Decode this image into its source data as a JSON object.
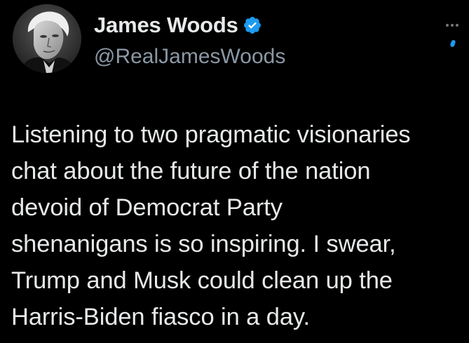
{
  "author": {
    "display_name": "James Woods",
    "handle": "@RealJamesWoods",
    "verified_icon": "verified-badge-icon",
    "avatar_icon": "profile-photo"
  },
  "menu": {
    "icon": "more-options-icon"
  },
  "tweet": {
    "text": "Listening to two pragmatic visionaries\nchat about the future of the nation\ndevoid of Democrat Party\nshenanigans is so inspiring. I swear,\nTrump and Musk could clean up the\nHarris-Biden fiasco in a day."
  },
  "colors": {
    "background": "#000000",
    "text": "#e7e9ea",
    "secondary_text": "#8b98a5",
    "verified_blue": "#1d9bf0"
  }
}
